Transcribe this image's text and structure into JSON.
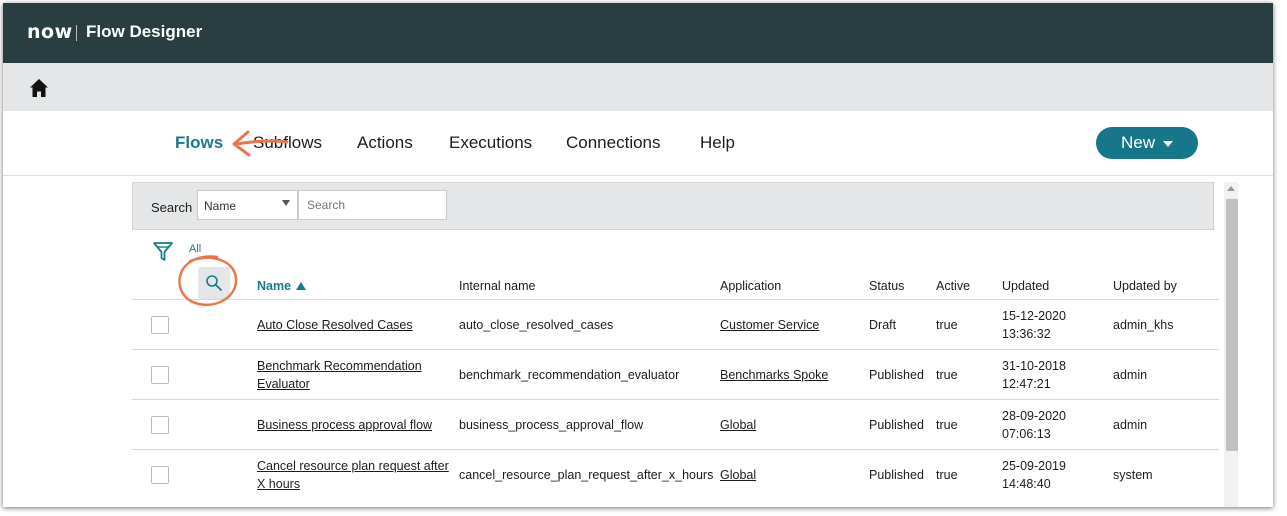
{
  "header": {
    "logo_text": "now",
    "app_title": "Flow Designer"
  },
  "nav": {
    "tabs": [
      {
        "label": "Flows",
        "active": true
      },
      {
        "label": "Subflows"
      },
      {
        "label": "Actions"
      },
      {
        "label": "Executions"
      },
      {
        "label": "Connections"
      },
      {
        "label": "Help"
      }
    ],
    "new_label": "New"
  },
  "search": {
    "label": "Search",
    "field_value": "Name",
    "placeholder": "Search"
  },
  "filter": {
    "label": "All"
  },
  "table": {
    "columns": [
      "Name",
      "Internal name",
      "Application",
      "Status",
      "Active",
      "Updated",
      "Updated by"
    ],
    "rows": [
      {
        "name1": "Auto Close Resolved Cases",
        "name2": "",
        "internal": "auto_close_resolved_cases",
        "application": "Customer Service",
        "status": "Draft",
        "active": "true",
        "updated_date": "15-12-2020",
        "updated_time": "13:36:32",
        "updated_by": "admin_khs"
      },
      {
        "name1": "Benchmark Recommendation",
        "name2": "Evaluator",
        "internal": "benchmark_recommendation_evaluator",
        "application": "Benchmarks Spoke",
        "status": "Published",
        "active": "true",
        "updated_date": "31-10-2018",
        "updated_time": "12:47:21",
        "updated_by": "admin"
      },
      {
        "name1": "Business process approval flow",
        "name2": "",
        "internal": "business_process_approval_flow",
        "application": "Global",
        "status": "Published",
        "active": "true",
        "updated_date": "28-09-2020",
        "updated_time": "07:06:13",
        "updated_by": "admin"
      },
      {
        "name1": "Cancel resource plan request after",
        "name2": "X hours",
        "internal": "cancel_resource_plan_request_after_x_hours",
        "application": "Global",
        "status": "Published",
        "active": "true",
        "updated_date": "25-09-2019",
        "updated_time": "14:48:40",
        "updated_by": "system"
      }
    ]
  },
  "colors": {
    "header_bg": "#293e40",
    "accent": "#1b7a8a",
    "button": "#157789",
    "annotation": "#e8784a"
  },
  "icons": [
    "home-icon",
    "filter-icon",
    "search-icon",
    "chevron-down-icon",
    "sort-ascending-icon"
  ]
}
